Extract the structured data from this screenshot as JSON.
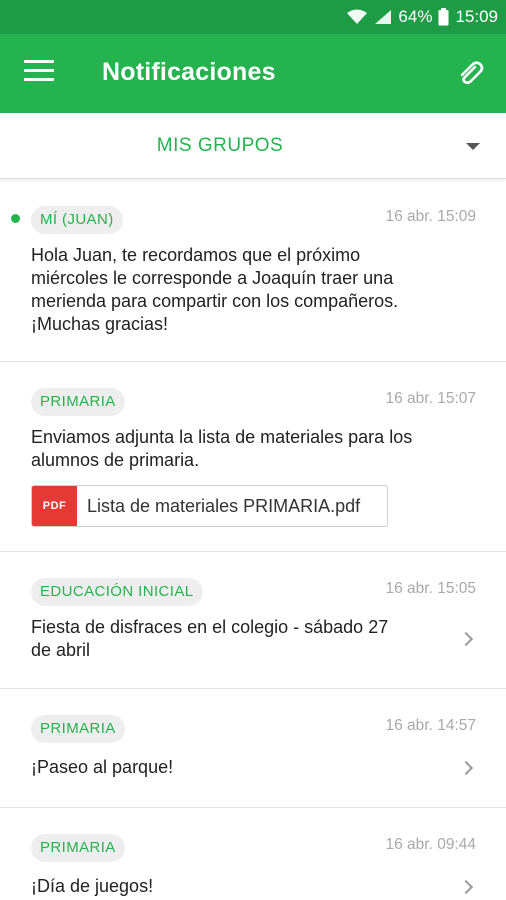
{
  "status_bar": {
    "battery": "64%",
    "time": "15:09"
  },
  "app_bar": {
    "title": "Notificaciones"
  },
  "group_selector": {
    "label": "MIS GRUPOS"
  },
  "notifications": [
    {
      "group": "MÍ (JUAN)",
      "time": "16 abr. 15:09",
      "unread": true,
      "message_lines": [
        "Hola Juan, te recordamos que el próximo",
        "miércoles le corresponde a Joaquín traer una",
        "merienda para compartir con los compañeros.",
        "¡Muchas gracias!"
      ]
    },
    {
      "group": "PRIMARIA",
      "time": "16 abr. 15:07",
      "message_lines": [
        "Enviamos adjunta la lista de materiales para los",
        "alumnos de primaria."
      ],
      "attachment": {
        "type": "PDF",
        "name": "Lista de materiales PRIMARIA.pdf"
      }
    },
    {
      "group": "EDUCACIÓN INICIAL",
      "time": "16 abr. 15:05",
      "message_lines": [
        "Fiesta de disfraces en el colegio - sábado 27",
        "de abril"
      ]
    },
    {
      "group": "PRIMARIA",
      "time": "16 abr. 14:57",
      "message_lines": [
        "¡Paseo al parque!"
      ]
    },
    {
      "group": "PRIMARIA",
      "time": "16 abr. 09:44",
      "message_lines": [
        "¡Día de juegos!"
      ]
    }
  ],
  "colors": {
    "primary": "#25b34f",
    "status_bar": "#1e9c45",
    "pdf": "#e53935"
  },
  "icons": [
    "wifi-icon",
    "signal-icon",
    "battery-icon",
    "menu-icon",
    "paperclip-icon",
    "caret-down-icon",
    "chevron-right-icon",
    "pdf-icon"
  ]
}
